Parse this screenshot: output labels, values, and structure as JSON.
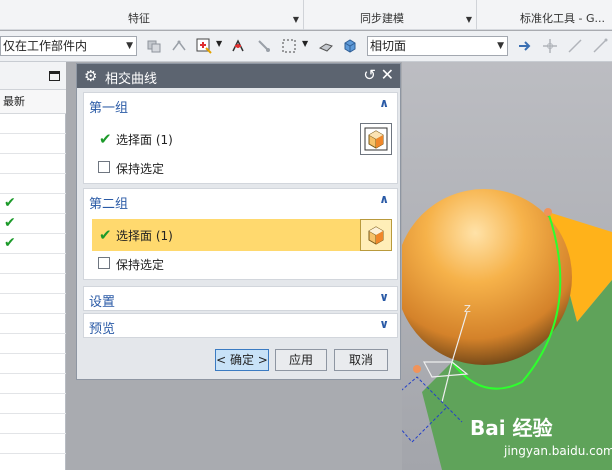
{
  "ribbon": {
    "groups": [
      {
        "label": "特征"
      },
      {
        "label": "同步建模"
      },
      {
        "label": "标准化工具 - G..."
      }
    ]
  },
  "toolbar": {
    "scope_combo": "仅在工作部件内",
    "face_rule_combo": "相切面"
  },
  "navigator": {
    "column_header": "最新",
    "rows": [
      {
        "checked": false
      },
      {
        "checked": false
      },
      {
        "checked": false
      },
      {
        "checked": false
      },
      {
        "checked": true
      },
      {
        "checked": true
      },
      {
        "checked": true
      },
      {
        "checked": false
      },
      {
        "checked": false
      },
      {
        "checked": false
      },
      {
        "checked": false
      },
      {
        "checked": false
      },
      {
        "checked": false
      },
      {
        "checked": false
      },
      {
        "checked": false
      },
      {
        "checked": false
      },
      {
        "checked": false
      }
    ]
  },
  "dialog": {
    "title": "相交曲线",
    "group1": {
      "title": "第一组",
      "select_label": "选择面 (1)",
      "keep_label": "保持选定"
    },
    "group2": {
      "title": "第二组",
      "select_label": "选择面 (1)",
      "keep_label": "保持选定"
    },
    "settings_title": "设置",
    "preview_title": "预览",
    "ok_label": "< 确定 >",
    "apply_label": "应用",
    "cancel_label": "取消"
  },
  "viewport": {
    "axis_label": "Z"
  },
  "watermark": {
    "brand": "Bai 经验",
    "url": "jingyan.baidu.com"
  },
  "colors": {
    "active_row": "#ffd96e",
    "section_title": "#2a5aa6",
    "sphere": "#f0a53c",
    "green_face": "#5fa35a",
    "orange_face": "#ffb21a",
    "title_bar": "#5c6470"
  }
}
